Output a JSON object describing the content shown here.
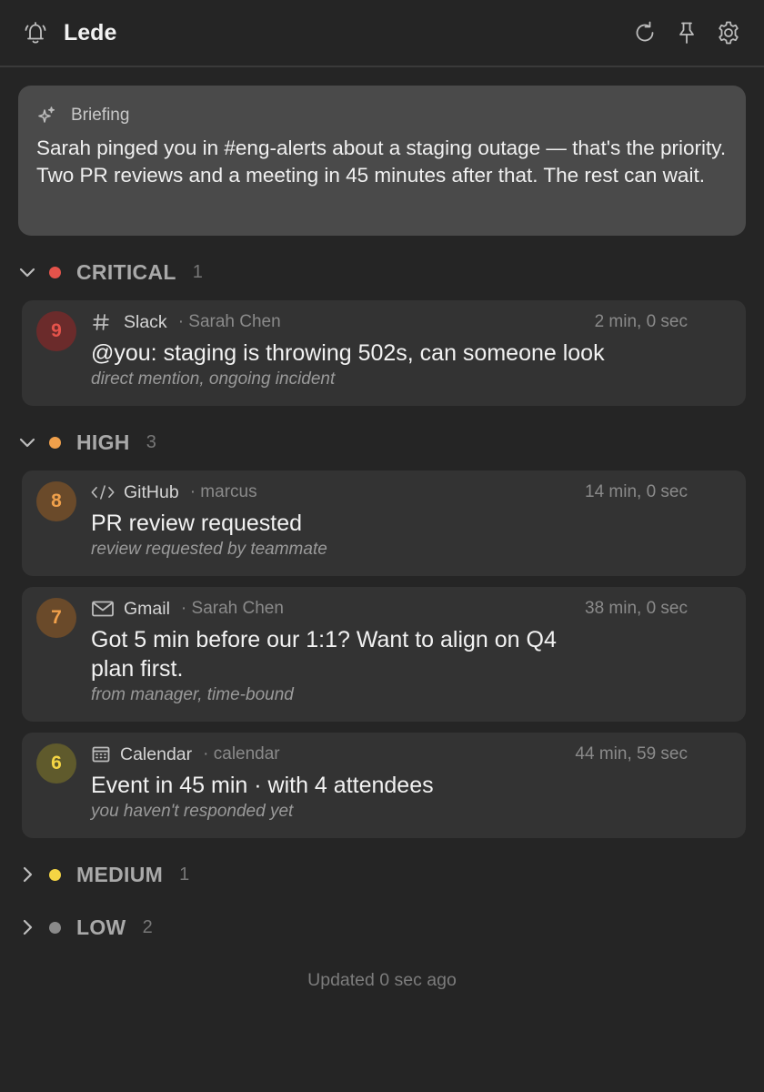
{
  "app": {
    "title": "Lede"
  },
  "briefing": {
    "label": "Briefing",
    "text": "Sarah pinged you in #eng-alerts about a staging outage — that's the priority. Two PR reviews and a meeting in 45 minutes after that. The rest can wait."
  },
  "sections": {
    "critical": {
      "label": "CRITICAL",
      "count": "1",
      "color": "#e5534b",
      "expanded": true
    },
    "high": {
      "label": "HIGH",
      "count": "3",
      "color": "#f0a04b",
      "expanded": true
    },
    "medium": {
      "label": "MEDIUM",
      "count": "1",
      "color": "#f5d544",
      "expanded": false
    },
    "low": {
      "label": "LOW",
      "count": "2",
      "color": "#8a8a8a",
      "expanded": false
    }
  },
  "cards": {
    "slack": {
      "score": "9",
      "icon": "hash-icon",
      "source": "Slack",
      "sender": "· Sarah Chen",
      "time": "2 min, 0 sec",
      "message": "@you: staging is throwing 502s, can someone look",
      "reason": "direct mention, ongoing incident"
    },
    "github": {
      "score": "8",
      "icon": "code-icon",
      "source": "GitHub",
      "sender": "· marcus",
      "time": "14 min, 0 sec",
      "message": "PR review requested",
      "reason": "review requested by teammate"
    },
    "gmail": {
      "score": "7",
      "icon": "mail-icon",
      "source": "Gmail",
      "sender": "· Sarah Chen",
      "time": "38 min, 0 sec",
      "message": "Got 5 min before our 1:1? Want to align on Q4 plan first.",
      "reason": "from manager, time-bound"
    },
    "calendar": {
      "score": "6",
      "icon": "calendar-icon",
      "source": "Calendar",
      "sender": "· calendar",
      "time": "44 min, 59 sec",
      "message": "Event in 45 min · with 4 attendees",
      "reason": "you haven't responded yet"
    }
  },
  "footer": {
    "status": "Updated 0 sec ago"
  }
}
